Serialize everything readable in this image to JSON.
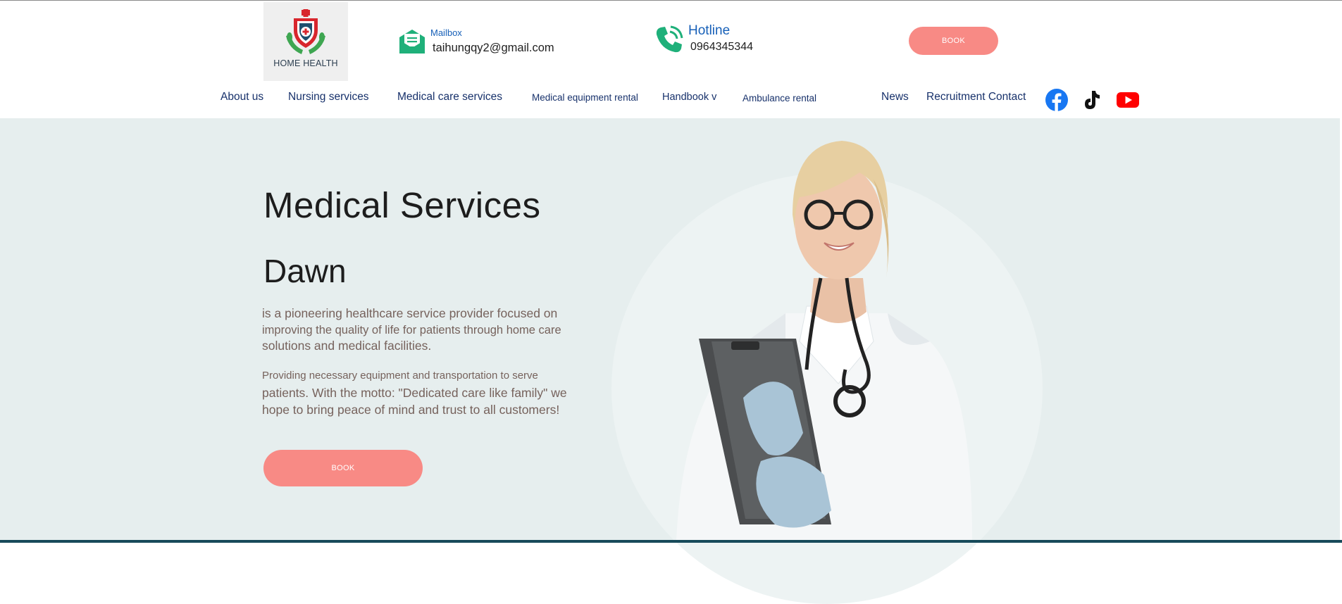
{
  "brand": {
    "logo_text": "HOME HEALTH"
  },
  "contact": {
    "mail_label": "Mailbox",
    "mail_value": "taihungqy2@gmail.com",
    "phone_label": "Hotline",
    "phone_value": "0964345344"
  },
  "header": {
    "book_label": "BOOK"
  },
  "nav": {
    "items": [
      "About us",
      "Nursing services",
      "Medical care services",
      "Medical equipment rental",
      "Handbook v",
      "Ambulance rental",
      "News",
      "Recruitment Contact"
    ]
  },
  "social": {
    "icons": [
      "facebook-icon",
      "tiktok-icon",
      "youtube-icon"
    ]
  },
  "hero": {
    "title": "Medical Services",
    "subtitle": "Dawn",
    "paragraph1_line1": "is a pioneering healthcare service provider focused on",
    "paragraph1_line2": "improving the quality of life for patients through home care",
    "paragraph1_line3": "solutions and medical facilities.",
    "paragraph2_line1": "Providing necessary equipment and transportation to serve",
    "paragraph2_line2": "patients. With the motto: \"Dedicated care like family\" we",
    "paragraph2_line3": "hope to bring peace of mind and trust to all customers!",
    "book_label": "BOOK"
  },
  "colors": {
    "accent_button": "#f88a85",
    "nav_text": "#17316b",
    "label_blue": "#1760b8",
    "icon_green": "#1fb07a",
    "hero_bg": "#e6eeee"
  }
}
